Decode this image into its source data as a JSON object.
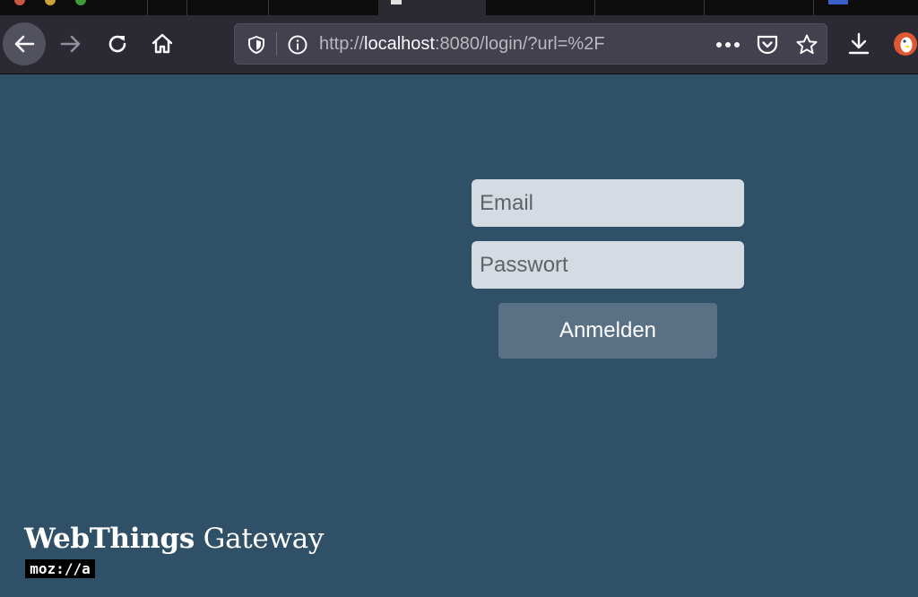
{
  "browser": {
    "url_prefix": "http://",
    "url_host": "localhost",
    "url_suffix": ":8080/login/?url=%2F",
    "icons": {
      "back": "arrow-left-icon",
      "forward": "arrow-right-icon",
      "reload": "reload-icon",
      "home": "home-icon",
      "tracking": "shield-icon",
      "info": "info-icon",
      "page_actions": "ellipsis-icon",
      "pocket": "pocket-icon",
      "bookmark": "star-icon",
      "downloads": "download-icon",
      "extension": "duckduckgo-icon"
    }
  },
  "login": {
    "email_placeholder": "Email",
    "password_placeholder": "Passwort",
    "submit_label": "Anmelden"
  },
  "branding": {
    "product_bold": "WebThings",
    "product_regular": "Gateway",
    "logo_text": "moz://a"
  },
  "colors": {
    "page_background": "#2f5066",
    "input_background": "#d4dbe2",
    "button_background": "#5a7185",
    "toolbar_background": "#2b2a33"
  }
}
